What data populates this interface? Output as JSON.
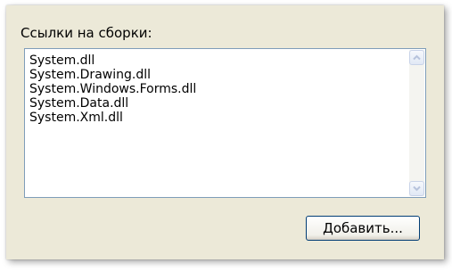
{
  "group": {
    "title": "Ссылки на сборки:"
  },
  "references": {
    "items": [
      "System.dll",
      "System.Drawing.dll",
      "System.Windows.Forms.dll",
      "System.Data.dll",
      "System.Xml.dll"
    ]
  },
  "scrollbar": {
    "up_icon": "chevron-up-icon",
    "down_icon": "chevron-down-icon"
  },
  "actions": {
    "add_label": "Добавить..."
  },
  "colors": {
    "panel_bg": "#ECE9D8",
    "list_border": "#7F9DB9",
    "button_border": "#003C74",
    "arrow": "#C1CCE4"
  }
}
